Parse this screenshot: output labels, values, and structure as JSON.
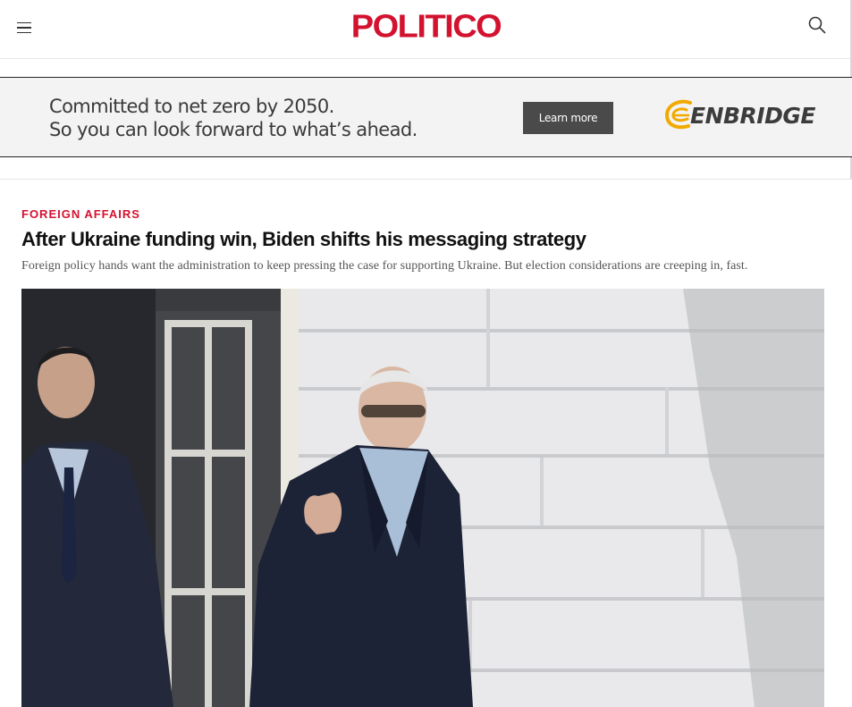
{
  "header": {
    "logo_text": "POLITICO",
    "menu_icon": "hamburger-menu-icon",
    "search_icon": "search-icon"
  },
  "ad": {
    "line1": "Committed to net zero by 2050.",
    "line2": "So you can look forward to what’s ahead.",
    "button_label": "Learn more",
    "brand_name": "ENBRIDGE",
    "brand_colors": {
      "swoosh": "#f2a900",
      "text": "#3c3c3c"
    }
  },
  "article": {
    "kicker": "FOREIGN AFFAIRS",
    "headline": "After Ukraine funding win, Biden shifts his messaging strategy",
    "dek": "Foreign policy hands want the administration to keep pressing the case for supporting Ukraine. But election considerations are creeping in, fast."
  },
  "colors": {
    "brand_red": "#d3122f",
    "ad_background": "#f3f3f3",
    "button_background": "#4a4a4a"
  }
}
